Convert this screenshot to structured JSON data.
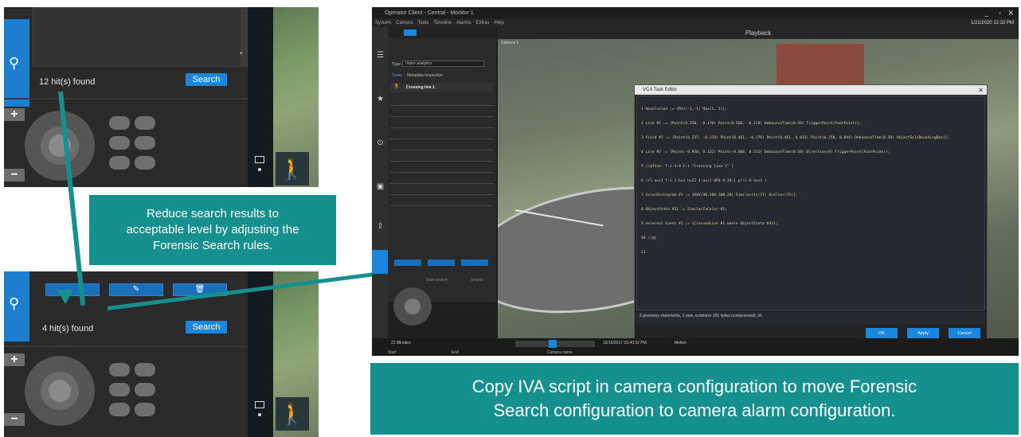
{
  "left_top": {
    "hits_text": "12 hit(s) found",
    "search_label": "Search",
    "plus": "+",
    "minus": "−"
  },
  "left_bottom": {
    "hits_text": "4 hit(s) found",
    "search_label": "Search",
    "plus": "+",
    "minus": "−"
  },
  "callout": {
    "line1": "Reduce search results to",
    "line2": "acceptable level by adjusting the",
    "line3": "Forensic Search rules."
  },
  "banner": {
    "line1": "Copy IVA script in camera configuration to move Forensic",
    "line2": "Search configuration to camera alarm configuration."
  },
  "app": {
    "title": "Operator Client - Central - Monitor 1",
    "menu": [
      "System",
      "Camera",
      "Tools",
      "Timeline",
      "Alarms",
      "Extras",
      "Help"
    ],
    "datetime": "1/21/2020 12:32 PM",
    "playback": "Playback",
    "camera_label": "Camera 1",
    "type_label": "Type:",
    "type_value": "Video analytics",
    "tabs": [
      "Tasks",
      "Metadata Inspection"
    ],
    "task": "Crossing line 1",
    "search_label": "Search",
    "start_search": "Start search",
    "timeline_duration": "21 Minutes",
    "timeline_date": "12/15/2017 05:40:32 PM",
    "timeline_motion": "Motion",
    "start_label": "Start",
    "end_label": "End",
    "camera_name_label": "Camera name"
  },
  "dialog": {
    "title": "VCA Task Editor",
    "code_lines": [
      "1 Resolution := {Min(-1,-1) Max(1, 1)};",
      "2 Line #1 := {Point(0.250, -0.170) Point(0.506, -0.170) DebounceTime(0.50) TriggerPoint(FootPoint)};",
      "3 Field #1 := {Point(0.237, -0.170) Point(0.461, -0.170) Point(0.461, 0.033) Point(0.250, 0.044) DebounceTime(0.50) ObjectSel(BoundingBox)};",
      "4 Line #2 := {Point(-0.950, 0.132) Point(-0.606, 0.211) DebounceTime(0.50) Direction(0) TriggerPoint(FootPoint)};",
      "5 //@Task: T:2 V:0 I:1 \"Crossing line 1\" {",
      "6 //1 a=s1 f:2 1 b=1 h=32 4 a=s1 8F0 8 20:1 pr:2 0 a=s1 }",
      "7 ColorHistogram #1 := {HSV(40,100,100,20) Similarity(77) Outlier(75)};",
      "8 ObjectState #32 := SimilarToColor #1;",
      "9 external Event #1 := {CrossedLine #1 where ObjectState #32};",
      "10 //@}",
      "11"
    ],
    "status": "3 geometry statements, 1 task, scriptsize 391 bytes (compressed), ok.",
    "ok": "OK",
    "apply": "Apply",
    "cancel": "Cancel"
  },
  "colors": {
    "teal": "#15908f",
    "blue": "#1a86dd",
    "dark": "#2a2a2a"
  }
}
